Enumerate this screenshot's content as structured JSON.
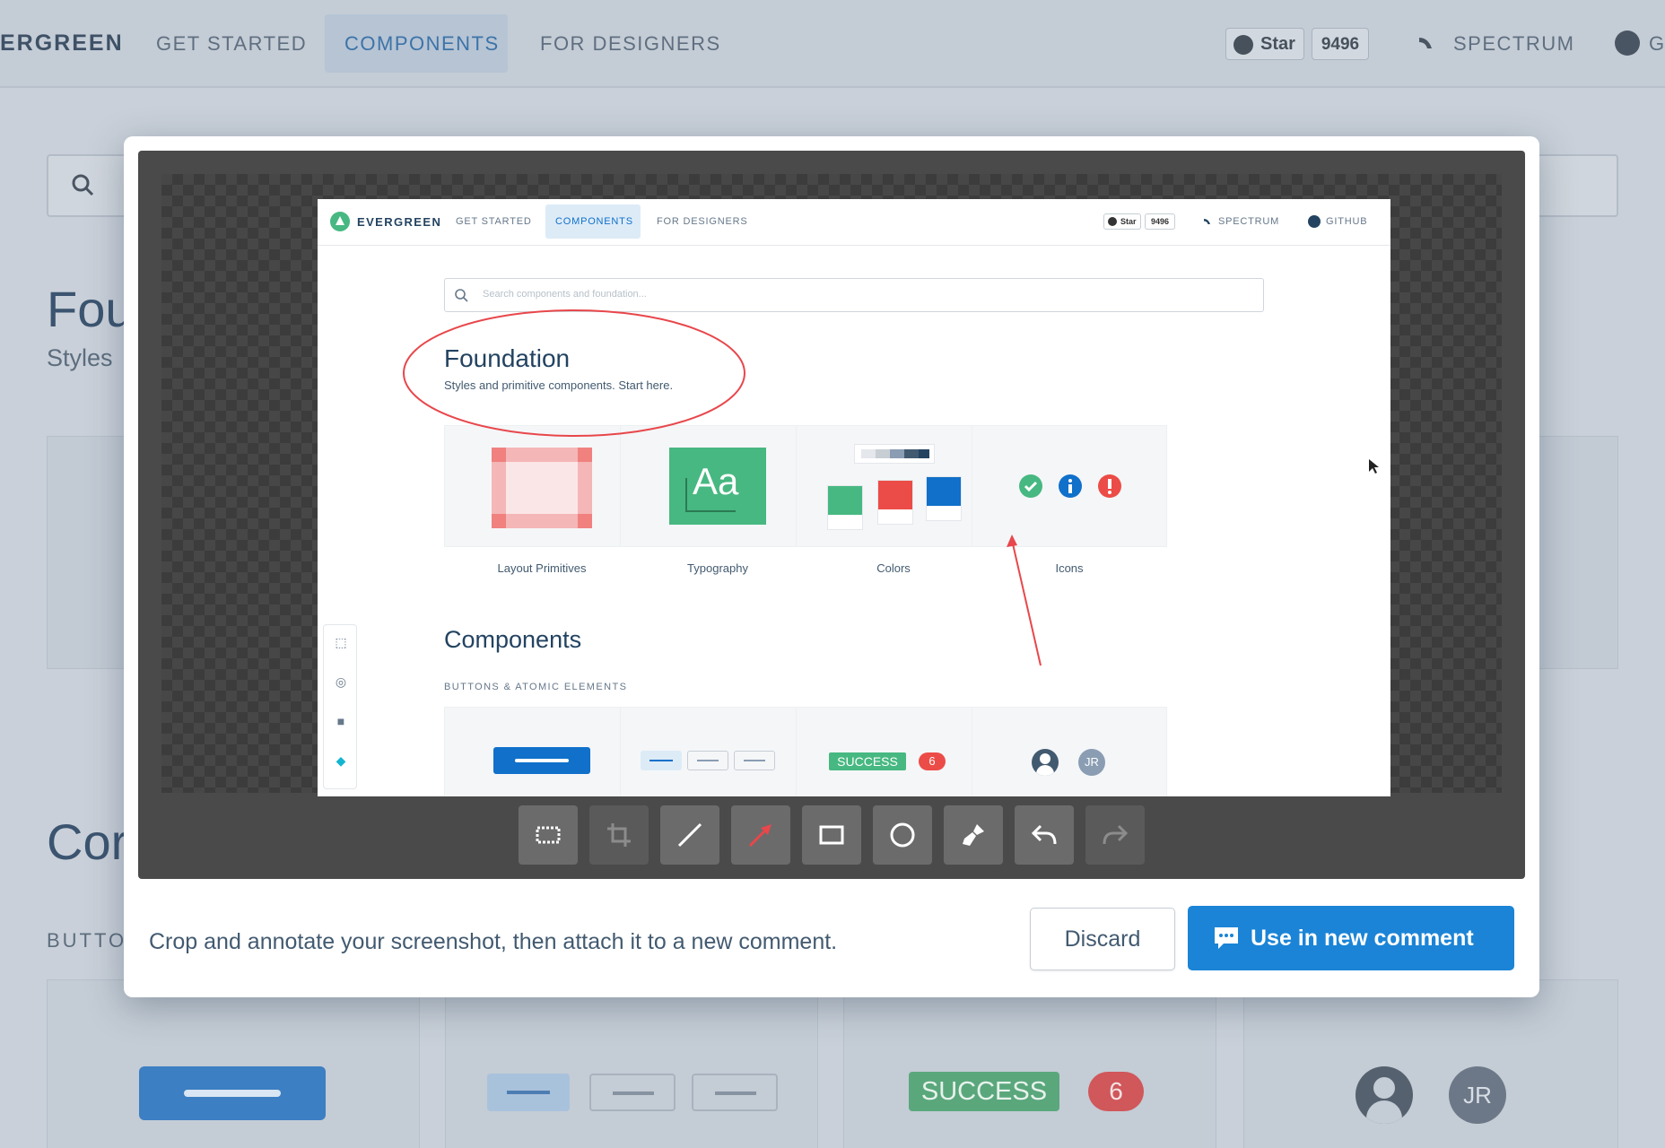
{
  "background": {
    "logo": "ERGREEN",
    "nav": [
      "GET STARTED",
      "COMPONENTS",
      "FOR DESIGNERS"
    ],
    "star_label": "Star",
    "star_count": "9496",
    "spectrum": "SPECTRUM",
    "github_partial": "G",
    "title_partial": "Fou",
    "subtitle_partial": "Styles",
    "title2_partial": "Cor",
    "section_partial": "BUTTO",
    "success_badge": "SUCCESS",
    "count_badge": "6",
    "avatar_initials": "JR"
  },
  "screenshot": {
    "logo": "EVERGREEN",
    "nav": [
      "GET STARTED",
      "COMPONENTS",
      "FOR DESIGNERS"
    ],
    "star_label": "Star",
    "star_count": "9496",
    "spectrum": "SPECTRUM",
    "github": "GITHUB",
    "search_placeholder": "Search components and foundation...",
    "foundation_title": "Foundation",
    "foundation_sub": "Styles and primitive components. Start here.",
    "cards": [
      "Layout Primitives",
      "Typography",
      "Colors",
      "Icons"
    ],
    "typography_glyph": "Aa",
    "components_title": "Components",
    "section_label": "BUTTONS & ATOMIC ELEMENTS",
    "success_badge": "SUCCESS",
    "count_badge": "6",
    "avatar_initials": "JR"
  },
  "toolbar": {
    "tools": [
      "select-tool",
      "crop-tool",
      "line-tool",
      "arrow-tool",
      "rectangle-tool",
      "ellipse-tool",
      "brush-tool",
      "undo-tool",
      "redo-tool"
    ]
  },
  "footer": {
    "instructions": "Crop and annotate your screenshot, then attach it to a new comment.",
    "discard": "Discard",
    "use_in_comment": "Use in new comment"
  },
  "colors": {
    "primary": "#1b84d6",
    "annotation_red": "#e8474b",
    "green": "#47b881",
    "brand_text": "#234361"
  }
}
